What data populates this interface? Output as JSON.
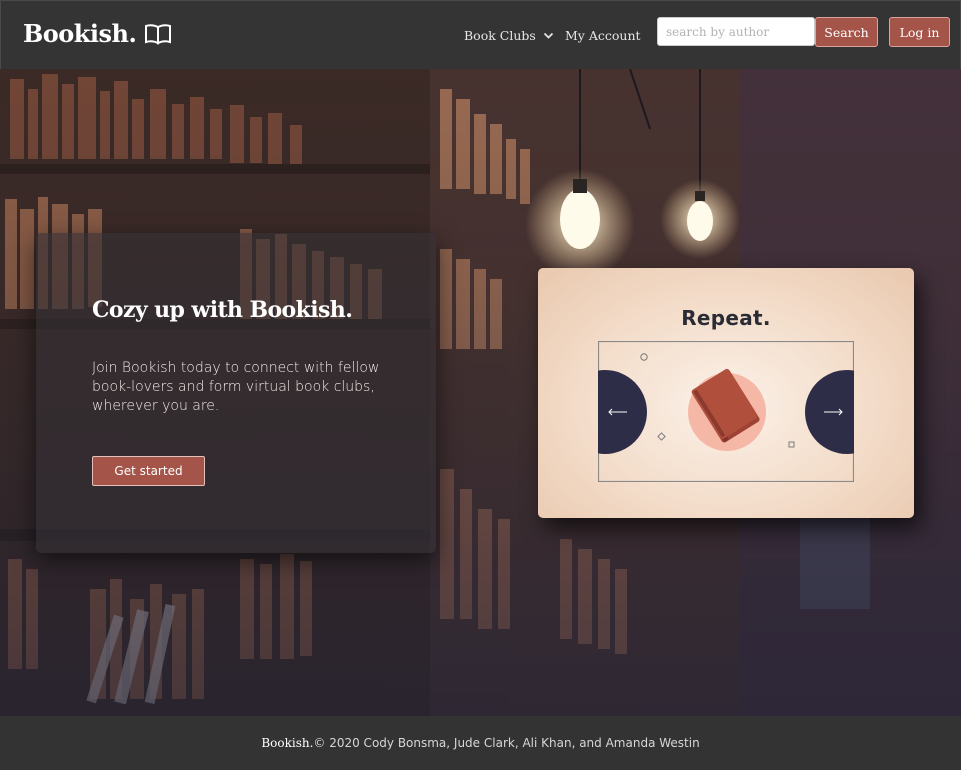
{
  "nav": {
    "brand": "Bookish.",
    "book_clubs": "Book Clubs",
    "my_account": "My Account",
    "search_placeholder": "search by author",
    "search_label": "Search",
    "login_label": "Log in"
  },
  "hero": {
    "title": "Cozy up with Bookish.",
    "text": "Join Bookish today to connect with fellow book-lovers and form virtual book clubs, wherever you are.",
    "cta": "Get started"
  },
  "carousel": {
    "slide_title": "Repeat."
  },
  "footer": {
    "brand": "Bookish.",
    "copyright": "© 2020 Cody Bonsma, Jude Clark, Ali Khan, and Amanda Westin"
  },
  "colors": {
    "accent": "#a5544a",
    "navbar": "#343434",
    "footer": "#333333",
    "navy": "#2e2d47"
  }
}
